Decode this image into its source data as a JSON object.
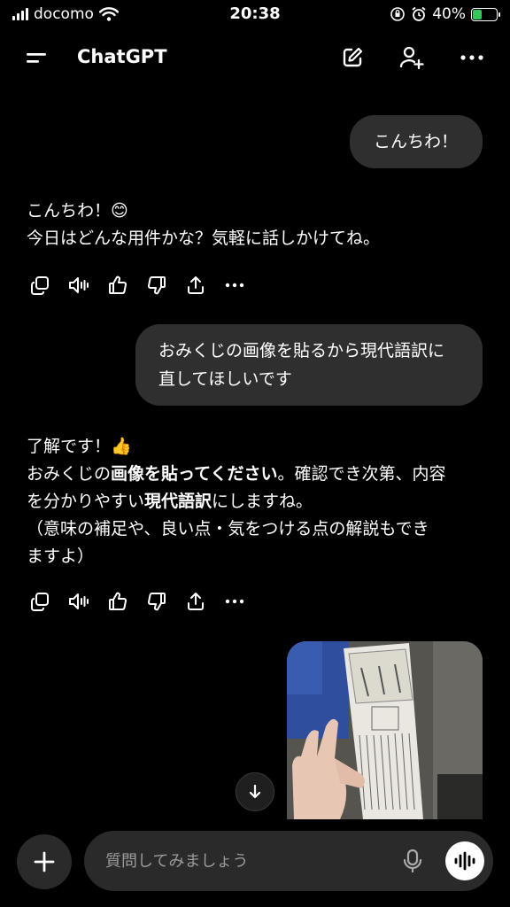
{
  "status_bar": {
    "carrier": "docomo",
    "time": "20:38",
    "battery": "40%",
    "battery_level": 0.4
  },
  "header": {
    "title": "ChatGPT"
  },
  "messages": {
    "user_1": "こんちわ！",
    "assistant_1": {
      "line1": "こんちわ！😊",
      "line2": "今日はどんな用件かな？気軽に話しかけてね。"
    },
    "user_2": {
      "line1": "おみくじの画像を貼るから現代語訳に",
      "line2": "直してほしいです"
    },
    "assistant_2": {
      "line1": "了解です！👍",
      "line2_pre": "おみくじの",
      "line2_bold": "画像を貼ってください",
      "line2_post": "。確認でき次第、内容",
      "line3_pre": "を分かりやすい",
      "line3_bold": "現代語訳",
      "line3_post": "にしますね。",
      "line4": "（意味の補足や、良い点・気をつける点の解説もでき",
      "line5": "ますよ）"
    }
  },
  "composer": {
    "placeholder": "質問してみましょう"
  },
  "icons": {
    "menu": "menu-icon",
    "new_chat": "edit-icon",
    "add_person": "add-person-icon",
    "more": "more-icon",
    "copy": "copy-icon",
    "speaker": "speaker-icon",
    "thumbs_up": "thumbs-up-icon",
    "thumbs_down": "thumbs-down-icon",
    "share": "share-icon",
    "plus": "plus-icon",
    "mic": "mic-icon",
    "voice": "voice-mode-icon",
    "arrow_down": "arrow-down-icon"
  },
  "colors": {
    "background": "#000000",
    "bubble": "#2f2f2f",
    "composer": "#2a2a2a",
    "battery": "#34c759"
  }
}
